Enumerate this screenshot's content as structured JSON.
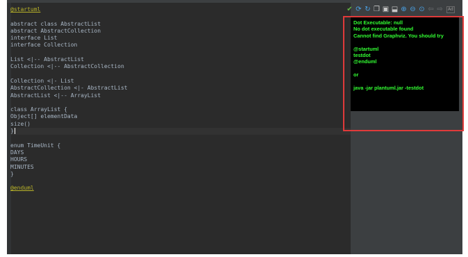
{
  "editor": {
    "lines": [
      {
        "text": "@startuml",
        "style": "directive"
      },
      {
        "text": ""
      },
      {
        "text": "abstract class AbstractList"
      },
      {
        "text": "abstract AbstractCollection"
      },
      {
        "text": "interface List"
      },
      {
        "text": "interface Collection"
      },
      {
        "text": ""
      },
      {
        "text": "List <|-- AbstractList"
      },
      {
        "text": "Collection <|-- AbstractCollection"
      },
      {
        "text": ""
      },
      {
        "text": "Collection <|- List"
      },
      {
        "text": "AbstractCollection <|- AbstractList"
      },
      {
        "text": "AbstractList <|-- ArrayList"
      },
      {
        "text": ""
      },
      {
        "text": "class ArrayList {"
      },
      {
        "text": "Object[] elementData"
      },
      {
        "text": "size()"
      },
      {
        "text": "}",
        "current": true
      },
      {
        "text": ""
      },
      {
        "text": "enum TimeUnit {"
      },
      {
        "text": "DAYS"
      },
      {
        "text": "HOURS"
      },
      {
        "text": "MINUTES"
      },
      {
        "text": "}"
      },
      {
        "text": ""
      },
      {
        "text": "@enduml",
        "style": "directive"
      }
    ]
  },
  "toolbar": {
    "ok_icon": "checkmark-icon",
    "buttons": [
      {
        "name": "refresh-icon",
        "glyph": "⟳"
      },
      {
        "name": "auto-refresh-icon",
        "glyph": "↻"
      },
      {
        "name": "copy-icon",
        "glyph": "❐"
      },
      {
        "name": "save-icon",
        "glyph": "▣"
      },
      {
        "name": "export-icon",
        "glyph": "⬓"
      },
      {
        "name": "zoom-in-icon",
        "glyph": "⊕"
      },
      {
        "name": "zoom-out-icon",
        "glyph": "⊖"
      },
      {
        "name": "zoom-actual-icon",
        "glyph": "⊙"
      },
      {
        "name": "back-icon",
        "glyph": "⇦"
      },
      {
        "name": "forward-icon",
        "glyph": "⇨"
      }
    ],
    "ad_label": "Ad"
  },
  "preview": {
    "lines": [
      "Dot Executable: null",
      "No dot executable found",
      "Cannot find Graphviz. You should try",
      "",
      "@startuml",
      "testdot",
      "@enduml",
      "",
      " or",
      "",
      "java -jar plantuml.jar -testdot"
    ]
  },
  "colors": {
    "editor_bg": "#2b2b2b",
    "panel_bg": "#3c3f41",
    "preview_text": "#33ff33",
    "highlight_border": "#e03a3a",
    "directive": "#bbb529"
  }
}
